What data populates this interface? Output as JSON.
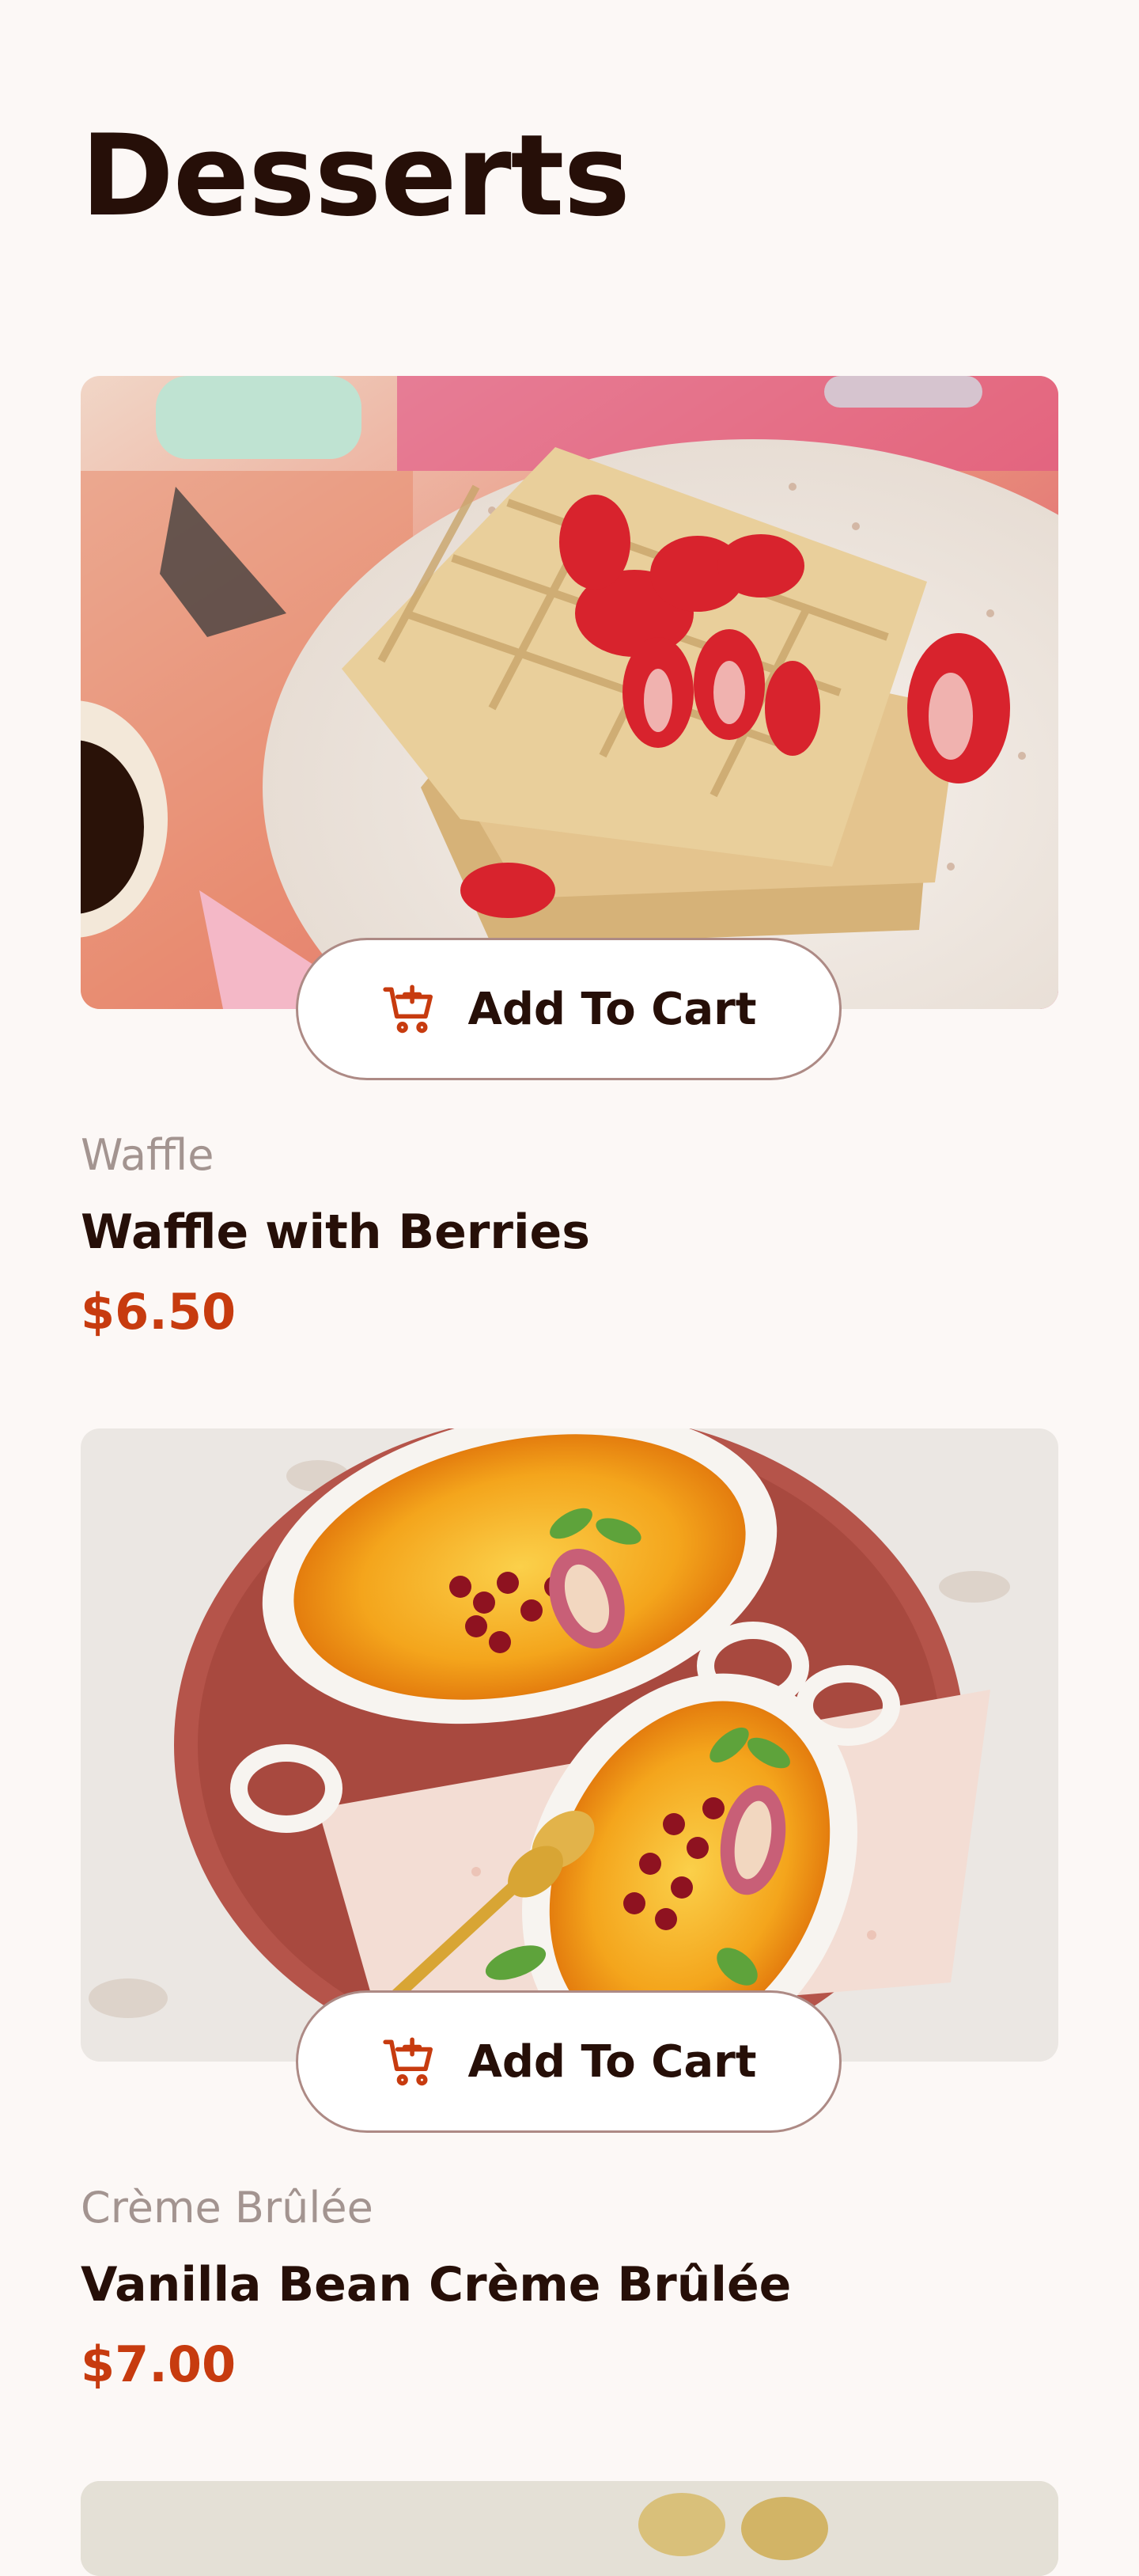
{
  "page": {
    "title": "Desserts"
  },
  "products": [
    {
      "image_icon": "waffle-photo",
      "add_label": "Add To Cart",
      "category": "Waffle",
      "name": "Waffle with Berries",
      "price": "$6.50"
    },
    {
      "image_icon": "creme-brulee-photo",
      "add_label": "Add To Cart",
      "category": "Crème Brûlée",
      "name": "Vanilla Bean Crème Brûlée",
      "price": "$7.00"
    }
  ],
  "colors": {
    "background": "#fcf8f6",
    "text_dark": "#260f08",
    "accent_red": "#c73b0f",
    "muted": "#a39490",
    "button_border": "#ad8a85"
  }
}
